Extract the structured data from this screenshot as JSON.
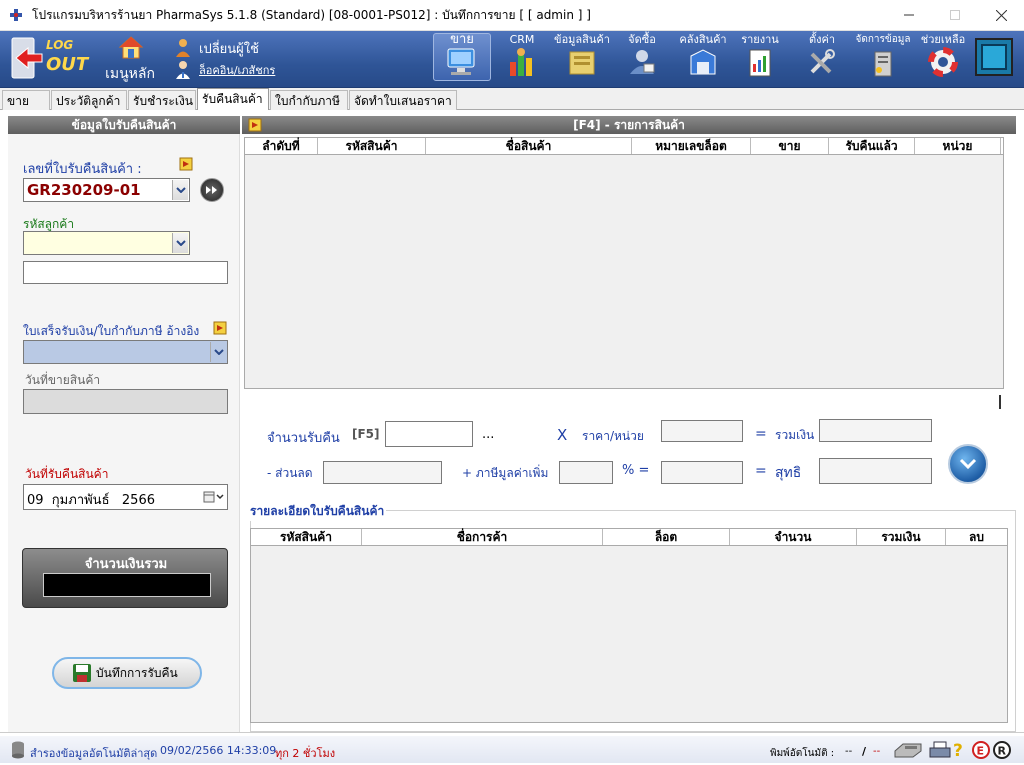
{
  "window": {
    "title": "โปรแกรมบริหารร้านยา PharmaSys 5.1.8 (Standard) [08-0001-PS012] : บันทึกการขาย  [ [ admin ] ]"
  },
  "toolbar": {
    "logout_top": "LOG",
    "logout_bottom": "OUT",
    "main_menu": "เมนูหลัก",
    "change_user": "เปลี่ยนผู้ใช้",
    "login_pharmacist": "ล็อคอิน/เภสัชกร",
    "items": [
      {
        "label": "ขาย",
        "icon": "cashier-icon"
      },
      {
        "label": "CRM",
        "icon": "crm-chart-icon"
      },
      {
        "label": "ข้อมูลสินค้า",
        "icon": "product-info-icon"
      },
      {
        "label": "จัดซื้อ",
        "icon": "purchase-icon"
      },
      {
        "label": "คลังสินค้า",
        "icon": "warehouse-icon"
      },
      {
        "label": "รายงาน",
        "icon": "report-icon"
      },
      {
        "label": "ตั้งค่า",
        "icon": "settings-tools-icon"
      },
      {
        "label": "จัดการข้อมูล",
        "icon": "data-manage-icon"
      },
      {
        "label": "ช่วยเหลือ",
        "icon": "help-lifebuoy-icon"
      }
    ]
  },
  "tabs": [
    {
      "label": "ขาย",
      "active": false
    },
    {
      "label": "ประวัติลูกค้า",
      "active": false
    },
    {
      "label": "รับชำระเงิน",
      "active": false
    },
    {
      "label": "รับคืนสินค้า",
      "active": true
    },
    {
      "label": "ใบกำกับภาษี",
      "active": false
    },
    {
      "label": "จัดทำใบเสนอราคา",
      "active": false
    }
  ],
  "left": {
    "header": "ข้อมูลใบรับคืนสินค้า",
    "return_no_label": "เลขที่ใบรับคืนสินค้า :",
    "return_no_value": "GR230209-01",
    "customer_code_label": "รหัสลูกค้า",
    "receipt_ref_label": "ใบเสร็จรับเงิน/ใบกำกับภาษี อ้างอิง",
    "sale_date_label": "วันที่ขายสินค้า",
    "return_date_label": "วันที่รับคืนสินค้า",
    "return_date_value": "09  กุมภาพันธ์   2566",
    "total_label": "จำนวนเงินรวม",
    "total_value": "",
    "save_button": "บันทึกการรับคืน"
  },
  "products": {
    "header": "[F4] - รายการสินค้า",
    "columns": [
      "ลำดับที่",
      "รหัสสินค้า",
      "ชื่อสินค้า",
      "หมายเลขล็อต",
      "ขาย",
      "รับคืนแล้ว",
      "หน่วย"
    ],
    "rows": []
  },
  "form": {
    "qty_label": "จำนวนรับคืน",
    "qty_key": "[F5]",
    "ellipsis": "...",
    "times": "X",
    "price_label": "ราคา/หน่วย",
    "equals": "=",
    "subtotal_label": "รวมเงิน",
    "discount_label": "- ส่วนลด",
    "vat_label": "+ ภาษีมูลค่าเพิ่ม",
    "percent_eq": "% =",
    "net_label": "สุทธิ"
  },
  "details": {
    "title": "รายละเอียดใบรับคืนสินค้า",
    "columns": [
      "รหัสสินค้า",
      "ชื่อการค้า",
      "ล็อต",
      "จำนวน",
      "รวมเงิน",
      "ลบ"
    ],
    "rows": []
  },
  "status": {
    "backup_label": "สำรองข้อมูลอัตโนมัติล่าสุด",
    "backup_time": "09/02/2566 14:33:09",
    "backup_interval": "ทุก 2 ชั่วโมง",
    "auto_print_label": "พิมพ์อัตโนมัติ :",
    "auto_print_value1": "--",
    "auto_print_sep": "/",
    "auto_print_value2": "--"
  },
  "colors": {
    "toolbar_blue": "#2f5597",
    "label_blue": "#1f3fa6",
    "return_no_red": "#8b0000",
    "customer_field": "#ffffe1",
    "receipt_field": "#b9c9e4"
  }
}
